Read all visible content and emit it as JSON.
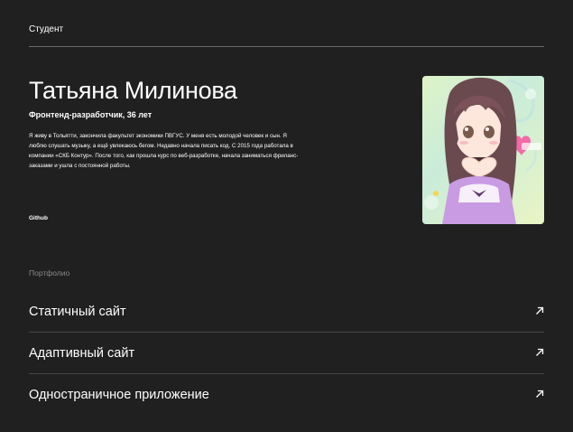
{
  "header": {
    "title": "Студент"
  },
  "profile": {
    "name": "Татьяна Милинова",
    "role": "Фронтенд-разработчик, 36 лет",
    "bio": "Я живу в Тольятти, закончила факультет экономики ПВГУС. У меня есть молодой человек и сын. Я люблю слушать музыку, а ещё увлекаюсь бегом. Недавно начала писать код. С 2015 года работала в компании «СКБ Контур». После того, как прошла курс по веб-разработке, начала заниматься фриланс-заказами и ушла с постоянной работы.",
    "github_label": "Github",
    "photo_icon": "avatar-photo"
  },
  "portfolio": {
    "title": "Портфолио",
    "items": [
      {
        "label": "Статичный сайт",
        "icon": "arrow-up-right-icon"
      },
      {
        "label": "Адаптивный сайт",
        "icon": "arrow-up-right-icon"
      },
      {
        "label": "Одностраничное приложение",
        "icon": "arrow-up-right-icon"
      }
    ]
  },
  "colors": {
    "background": "#202020",
    "text": "#ffffff",
    "muted": "#8a8a8a",
    "divider": "#464646"
  }
}
